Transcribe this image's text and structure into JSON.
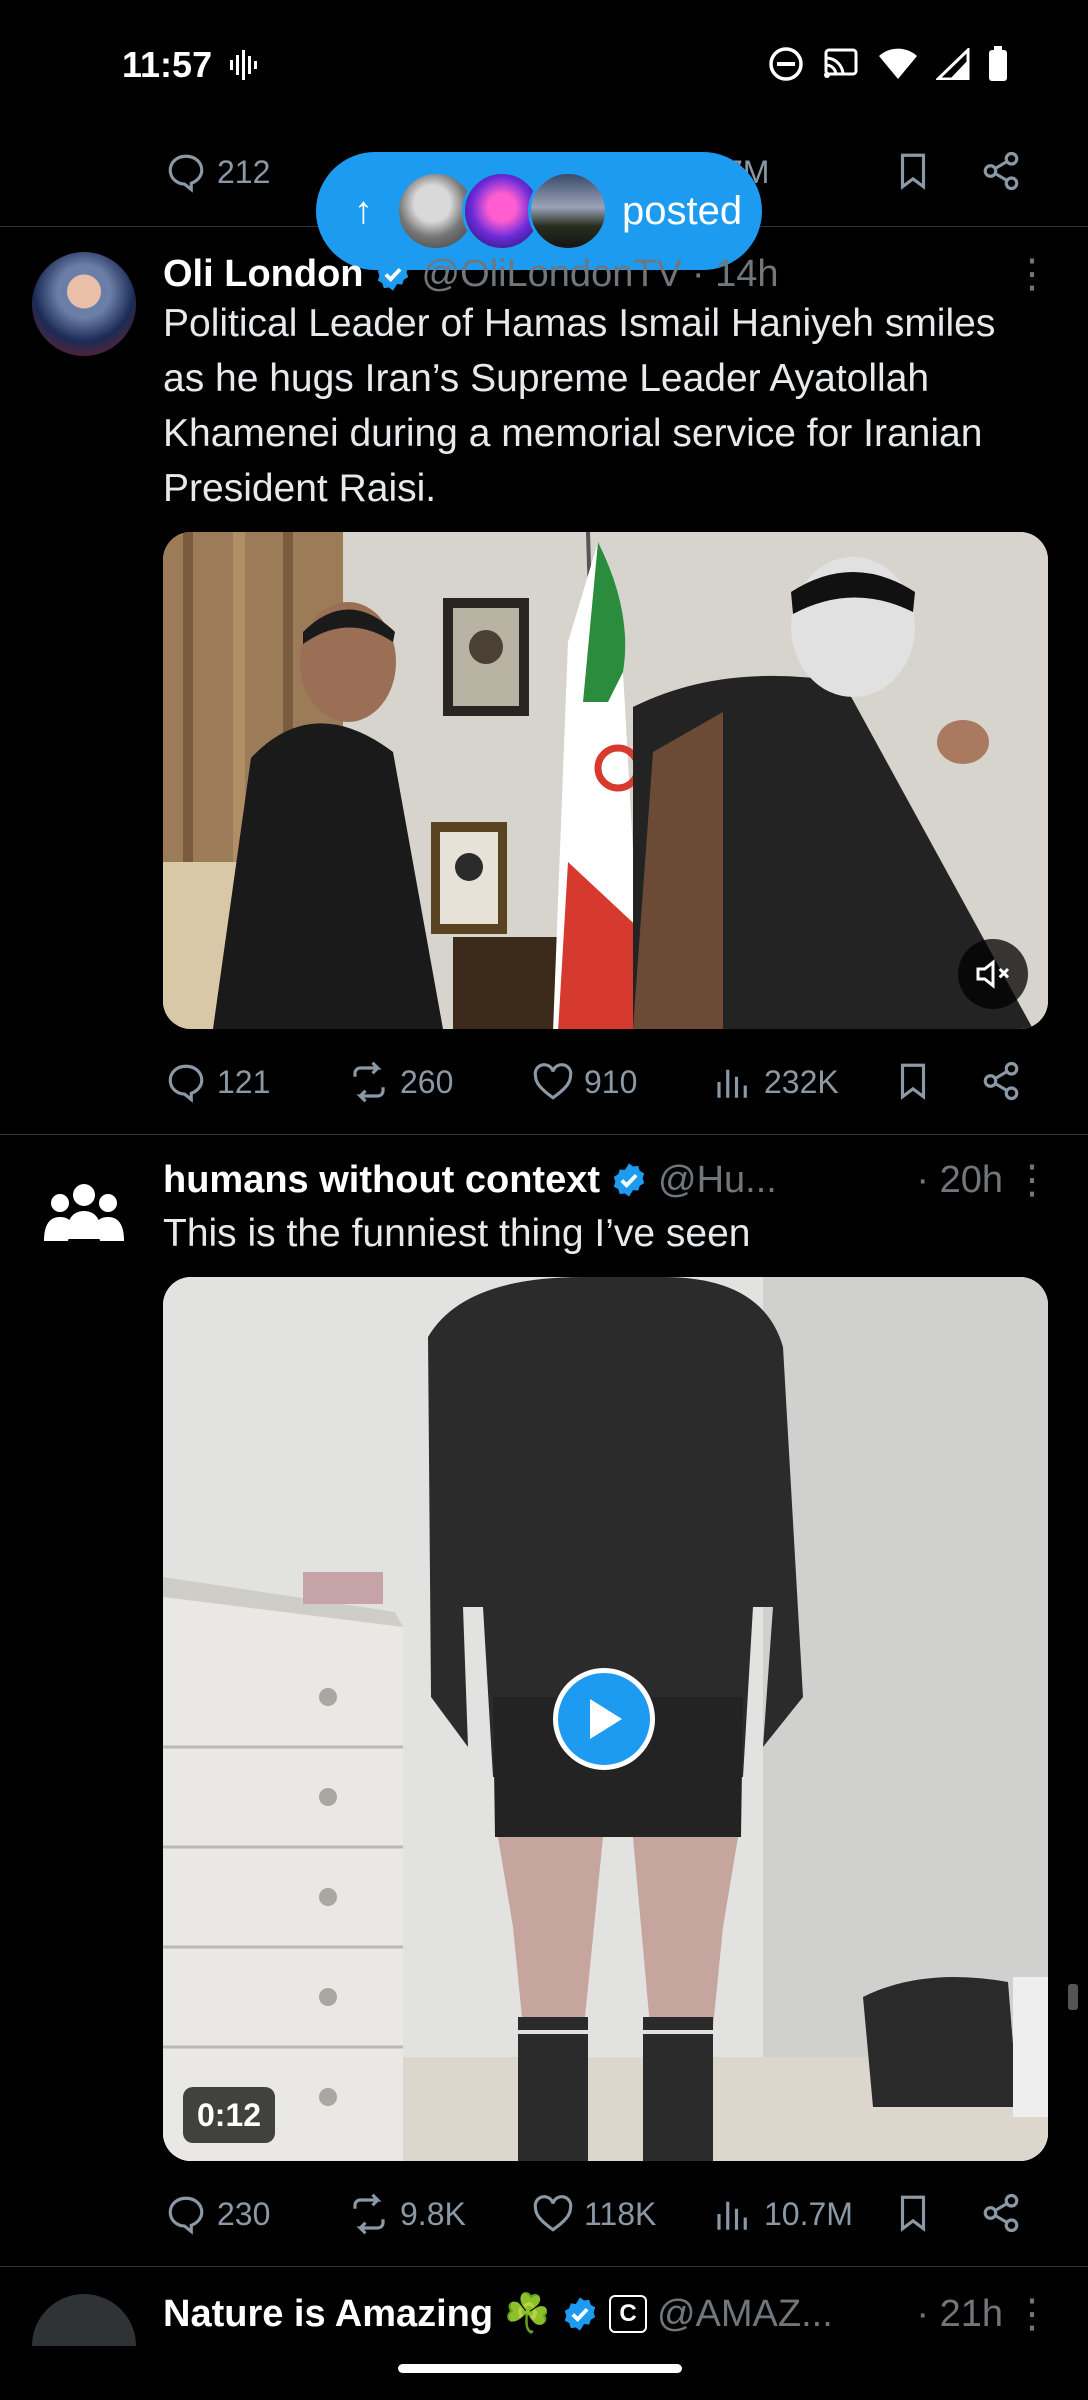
{
  "status_bar": {
    "time": "11:57"
  },
  "top_tweet_actions": {
    "replies": "212",
    "views": "7M"
  },
  "posted_pill": {
    "label": "posted"
  },
  "tweets": [
    {
      "name": "Oli London",
      "handle": "@OliLondonTV",
      "time": "· 14h",
      "text": "Political Leader of Hamas Ismail Haniyeh smiles as he hugs Iran’s Supreme Leader Ayatollah Khamenei during a memorial service for Iranian President Raisi.",
      "replies": "121",
      "reposts": "260",
      "likes": "910",
      "views": "232K"
    },
    {
      "name": "humans without context",
      "handle": "@Hu...",
      "time": "· 20h",
      "text": "This is the funniest thing I’ve seen",
      "video_duration": "0:12",
      "replies": "230",
      "reposts": "9.8K",
      "likes": "118K",
      "views": "10.7M"
    },
    {
      "name": "Nature is Amazing ☘️",
      "handle": "@AMAZ...",
      "time": "· 21h"
    }
  ],
  "colors": {
    "accent": "#1d9bf0",
    "muted": "#71767b",
    "background": "#000000"
  }
}
